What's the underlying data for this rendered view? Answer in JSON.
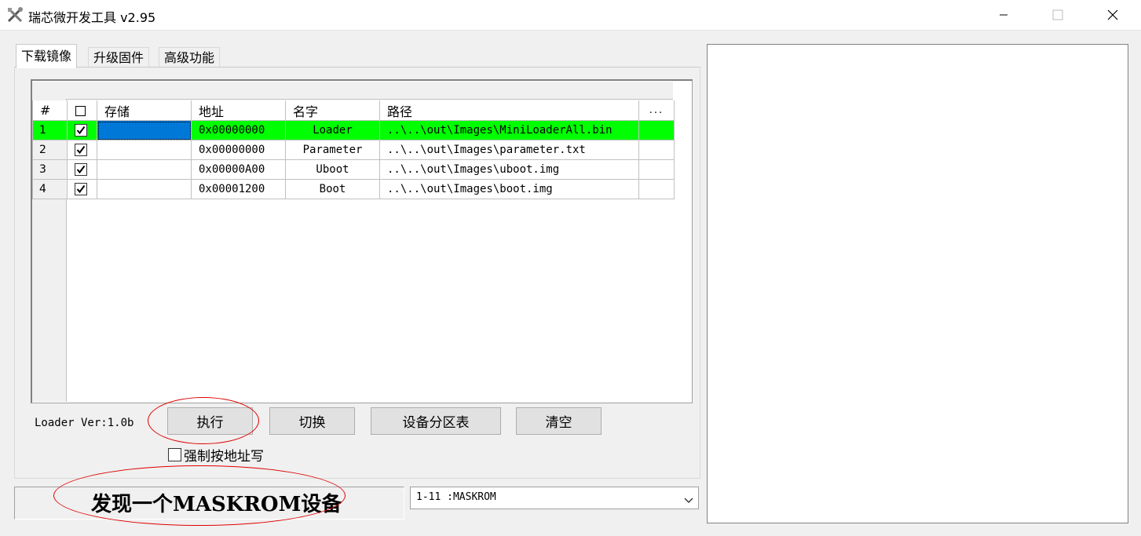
{
  "window": {
    "title": "瑞芯微开发工具 v2.95",
    "icon": "tools-icon",
    "controls": [
      "minimize",
      "maximize",
      "close"
    ]
  },
  "tabs": [
    {
      "label": "下载镜像",
      "active": true
    },
    {
      "label": "升级固件",
      "active": false
    },
    {
      "label": "高级功能",
      "active": false
    }
  ],
  "grid": {
    "columns": [
      "#",
      "",
      "存储",
      "地址",
      "名字",
      "路径",
      "..."
    ],
    "rows": [
      {
        "num": "1",
        "checked": true,
        "storage": "",
        "address": "0x00000000",
        "name": "Loader",
        "path": "..\\..\\out\\Images\\MiniLoaderAll.bin",
        "selected": true
      },
      {
        "num": "2",
        "checked": true,
        "storage": "",
        "address": "0x00000000",
        "name": "Parameter",
        "path": "..\\..\\out\\Images\\parameter.txt",
        "selected": false
      },
      {
        "num": "3",
        "checked": true,
        "storage": "",
        "address": "0x00000A00",
        "name": "Uboot",
        "path": "..\\..\\out\\Images\\uboot.img",
        "selected": false
      },
      {
        "num": "4",
        "checked": true,
        "storage": "",
        "address": "0x00001200",
        "name": "Boot",
        "path": "..\\..\\out\\Images\\boot.img",
        "selected": false
      }
    ]
  },
  "loader_version": "Loader Ver:1.0b",
  "buttons": {
    "run": "执行",
    "switch": "切换",
    "partition_table": "设备分区表",
    "clear": "清空"
  },
  "force_write": {
    "label": "强制按地址写",
    "checked": false
  },
  "status": "发现一个MASKROM设备",
  "device_select": {
    "value": "1-11 :MASKROM"
  },
  "colors": {
    "selected_row": "#00ff00",
    "selected_cell": "#0078d7",
    "annotation": "#e00000"
  }
}
